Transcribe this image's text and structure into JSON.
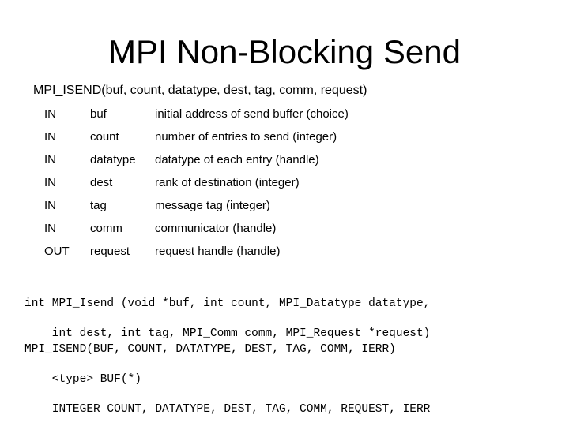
{
  "title": "MPI Non-Blocking Send",
  "signature": "MPI_ISEND(buf, count, datatype, dest, tag, comm, request)",
  "params": [
    {
      "dir": "IN",
      "name": "buf",
      "desc": "initial address of send buffer (choice)"
    },
    {
      "dir": "IN",
      "name": "count",
      "desc": "number of entries to send (integer)"
    },
    {
      "dir": "IN",
      "name": "datatype",
      "desc": "datatype of each entry (handle)"
    },
    {
      "dir": "IN",
      "name": "dest",
      "desc": "rank of destination (integer)"
    },
    {
      "dir": "IN",
      "name": "tag",
      "desc": "message tag (integer)"
    },
    {
      "dir": "IN",
      "name": "comm",
      "desc": "communicator (handle)"
    },
    {
      "dir": "OUT",
      "name": "request",
      "desc": "request handle (handle)"
    }
  ],
  "c_binding": [
    "int MPI_Isend (void *buf, int count, MPI_Datatype datatype,",
    "    int dest, int tag, MPI_Comm comm, MPI_Request *request)"
  ],
  "fortran_binding": [
    "MPI_ISEND(BUF, COUNT, DATATYPE, DEST, TAG, COMM, IERR)",
    "    <type> BUF(*)",
    "    INTEGER COUNT, DATATYPE, DEST, TAG, COMM, REQUEST, IERR"
  ]
}
